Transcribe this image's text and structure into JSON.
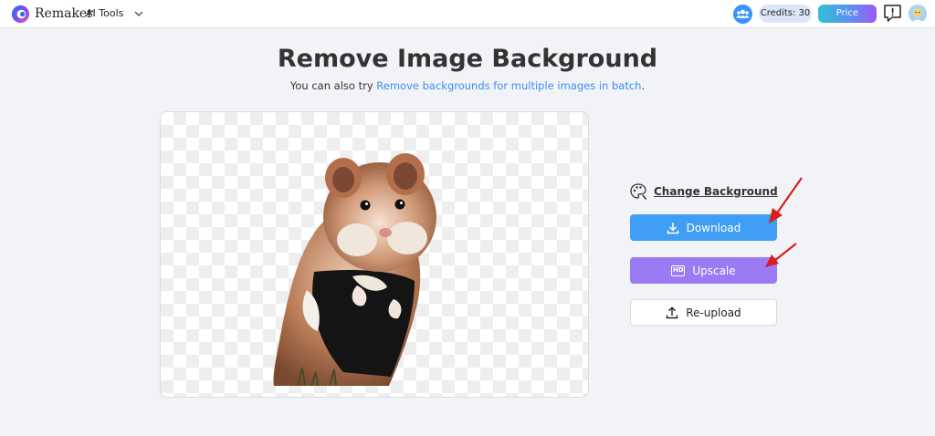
{
  "header": {
    "brand": "Remaker",
    "menu_label": "AI Tools",
    "credits": "Credits: 30",
    "price_label": "Price"
  },
  "hero": {
    "title": "Remove Image Background",
    "subtitle_prefix": "You can also try ",
    "subtitle_link": "Remove backgrounds for multiple images in batch",
    "subtitle_suffix": "."
  },
  "actions": {
    "change_background": "Change Background",
    "download": "Download",
    "upscale": "Upscale",
    "upscale_badge": "HD",
    "reupload": "Re-upload"
  },
  "colors": {
    "accent_blue": "#3f9df3",
    "accent_purple": "#9b7bf3",
    "annotation_red": "#d81e1e"
  },
  "icons": [
    "logo-icon",
    "chevron-down-icon",
    "community-icon",
    "feedback-icon",
    "avatar",
    "palette-icon",
    "download-icon",
    "hd-icon",
    "upload-icon"
  ]
}
